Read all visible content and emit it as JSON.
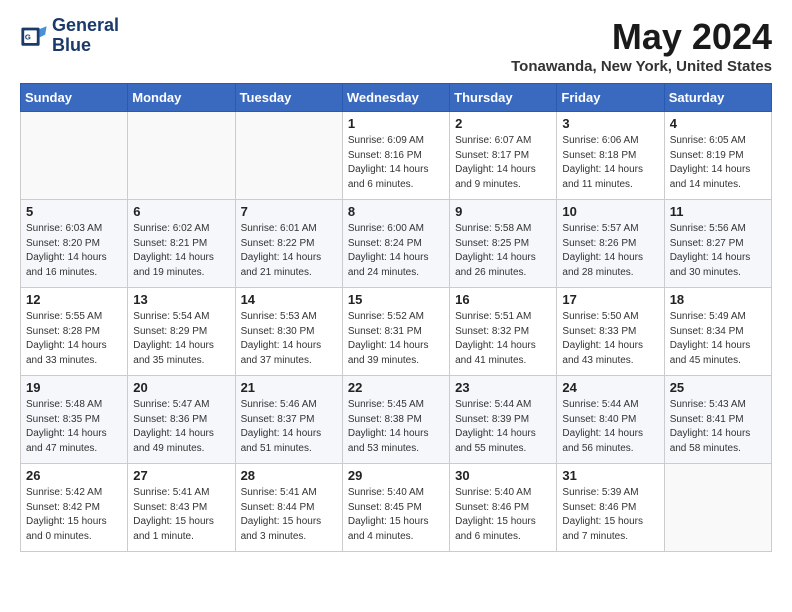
{
  "header": {
    "logo_line1": "General",
    "logo_line2": "Blue",
    "month_title": "May 2024",
    "location": "Tonawanda, New York, United States"
  },
  "weekdays": [
    "Sunday",
    "Monday",
    "Tuesday",
    "Wednesday",
    "Thursday",
    "Friday",
    "Saturday"
  ],
  "weeks": [
    [
      {
        "day": "",
        "info": ""
      },
      {
        "day": "",
        "info": ""
      },
      {
        "day": "",
        "info": ""
      },
      {
        "day": "1",
        "info": "Sunrise: 6:09 AM\nSunset: 8:16 PM\nDaylight: 14 hours\nand 6 minutes."
      },
      {
        "day": "2",
        "info": "Sunrise: 6:07 AM\nSunset: 8:17 PM\nDaylight: 14 hours\nand 9 minutes."
      },
      {
        "day": "3",
        "info": "Sunrise: 6:06 AM\nSunset: 8:18 PM\nDaylight: 14 hours\nand 11 minutes."
      },
      {
        "day": "4",
        "info": "Sunrise: 6:05 AM\nSunset: 8:19 PM\nDaylight: 14 hours\nand 14 minutes."
      }
    ],
    [
      {
        "day": "5",
        "info": "Sunrise: 6:03 AM\nSunset: 8:20 PM\nDaylight: 14 hours\nand 16 minutes."
      },
      {
        "day": "6",
        "info": "Sunrise: 6:02 AM\nSunset: 8:21 PM\nDaylight: 14 hours\nand 19 minutes."
      },
      {
        "day": "7",
        "info": "Sunrise: 6:01 AM\nSunset: 8:22 PM\nDaylight: 14 hours\nand 21 minutes."
      },
      {
        "day": "8",
        "info": "Sunrise: 6:00 AM\nSunset: 8:24 PM\nDaylight: 14 hours\nand 24 minutes."
      },
      {
        "day": "9",
        "info": "Sunrise: 5:58 AM\nSunset: 8:25 PM\nDaylight: 14 hours\nand 26 minutes."
      },
      {
        "day": "10",
        "info": "Sunrise: 5:57 AM\nSunset: 8:26 PM\nDaylight: 14 hours\nand 28 minutes."
      },
      {
        "day": "11",
        "info": "Sunrise: 5:56 AM\nSunset: 8:27 PM\nDaylight: 14 hours\nand 30 minutes."
      }
    ],
    [
      {
        "day": "12",
        "info": "Sunrise: 5:55 AM\nSunset: 8:28 PM\nDaylight: 14 hours\nand 33 minutes."
      },
      {
        "day": "13",
        "info": "Sunrise: 5:54 AM\nSunset: 8:29 PM\nDaylight: 14 hours\nand 35 minutes."
      },
      {
        "day": "14",
        "info": "Sunrise: 5:53 AM\nSunset: 8:30 PM\nDaylight: 14 hours\nand 37 minutes."
      },
      {
        "day": "15",
        "info": "Sunrise: 5:52 AM\nSunset: 8:31 PM\nDaylight: 14 hours\nand 39 minutes."
      },
      {
        "day": "16",
        "info": "Sunrise: 5:51 AM\nSunset: 8:32 PM\nDaylight: 14 hours\nand 41 minutes."
      },
      {
        "day": "17",
        "info": "Sunrise: 5:50 AM\nSunset: 8:33 PM\nDaylight: 14 hours\nand 43 minutes."
      },
      {
        "day": "18",
        "info": "Sunrise: 5:49 AM\nSunset: 8:34 PM\nDaylight: 14 hours\nand 45 minutes."
      }
    ],
    [
      {
        "day": "19",
        "info": "Sunrise: 5:48 AM\nSunset: 8:35 PM\nDaylight: 14 hours\nand 47 minutes."
      },
      {
        "day": "20",
        "info": "Sunrise: 5:47 AM\nSunset: 8:36 PM\nDaylight: 14 hours\nand 49 minutes."
      },
      {
        "day": "21",
        "info": "Sunrise: 5:46 AM\nSunset: 8:37 PM\nDaylight: 14 hours\nand 51 minutes."
      },
      {
        "day": "22",
        "info": "Sunrise: 5:45 AM\nSunset: 8:38 PM\nDaylight: 14 hours\nand 53 minutes."
      },
      {
        "day": "23",
        "info": "Sunrise: 5:44 AM\nSunset: 8:39 PM\nDaylight: 14 hours\nand 55 minutes."
      },
      {
        "day": "24",
        "info": "Sunrise: 5:44 AM\nSunset: 8:40 PM\nDaylight: 14 hours\nand 56 minutes."
      },
      {
        "day": "25",
        "info": "Sunrise: 5:43 AM\nSunset: 8:41 PM\nDaylight: 14 hours\nand 58 minutes."
      }
    ],
    [
      {
        "day": "26",
        "info": "Sunrise: 5:42 AM\nSunset: 8:42 PM\nDaylight: 15 hours\nand 0 minutes."
      },
      {
        "day": "27",
        "info": "Sunrise: 5:41 AM\nSunset: 8:43 PM\nDaylight: 15 hours\nand 1 minute."
      },
      {
        "day": "28",
        "info": "Sunrise: 5:41 AM\nSunset: 8:44 PM\nDaylight: 15 hours\nand 3 minutes."
      },
      {
        "day": "29",
        "info": "Sunrise: 5:40 AM\nSunset: 8:45 PM\nDaylight: 15 hours\nand 4 minutes."
      },
      {
        "day": "30",
        "info": "Sunrise: 5:40 AM\nSunset: 8:46 PM\nDaylight: 15 hours\nand 6 minutes."
      },
      {
        "day": "31",
        "info": "Sunrise: 5:39 AM\nSunset: 8:46 PM\nDaylight: 15 hours\nand 7 minutes."
      },
      {
        "day": "",
        "info": ""
      }
    ]
  ]
}
